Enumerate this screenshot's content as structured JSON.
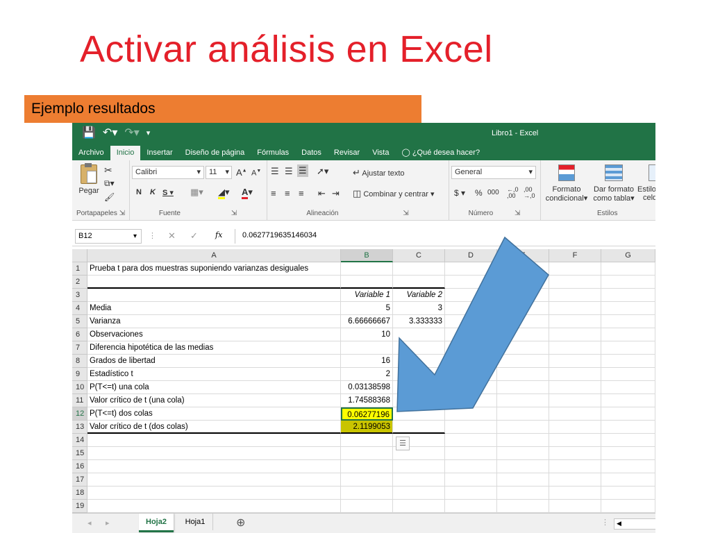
{
  "slide": {
    "title": "Activar análisis en Excel",
    "banner": "Ejemplo resultados"
  },
  "excel": {
    "window_title": "Libro1 - Excel",
    "menu_tabs": [
      "Archivo",
      "Inicio",
      "Insertar",
      "Diseño de página",
      "Fórmulas",
      "Datos",
      "Revisar",
      "Vista"
    ],
    "tell_me": "¿Qué desea hacer?",
    "ribbon": {
      "paste": "Pegar",
      "font_name": "Calibri",
      "font_size": "11",
      "wrap_text": "Ajustar texto",
      "merge_center": "Combinar y centrar",
      "number_format": "General",
      "conditional_format_1": "Formato",
      "conditional_format_2": "condicional",
      "format_table_1": "Dar formato",
      "format_table_2": "como tabla",
      "cell_styles_1": "Estilo",
      "cell_styles_2": "celd",
      "group_portapapeles": "Portapapeles",
      "group_fuente": "Fuente",
      "group_alineacion": "Alineación",
      "group_numero": "Número",
      "group_estilos": "Estilos"
    },
    "name_box": "B12",
    "formula_value": "0.0627719635146034",
    "columns": [
      "A",
      "B",
      "C",
      "D",
      "E",
      "F",
      "G"
    ],
    "rows": [
      {
        "n": "1",
        "a": "Prueba t para dos muestras suponiendo varianzas desiguales",
        "b": "",
        "c": ""
      },
      {
        "n": "2",
        "a": "",
        "b": "",
        "c": ""
      },
      {
        "n": "3",
        "a": "",
        "b": "Variable 1",
        "c": "Variable 2"
      },
      {
        "n": "4",
        "a": "Media",
        "b": "5",
        "c": "3"
      },
      {
        "n": "5",
        "a": "Varianza",
        "b": "6.66666667",
        "c": "3.333333"
      },
      {
        "n": "6",
        "a": "Observaciones",
        "b": "10",
        "c": ""
      },
      {
        "n": "7",
        "a": "Diferencia hipotética de las medias",
        "b": "",
        "c": ""
      },
      {
        "n": "8",
        "a": "Grados de libertad",
        "b": "16",
        "c": ""
      },
      {
        "n": "9",
        "a": "Estadístico t",
        "b": "2",
        "c": ""
      },
      {
        "n": "10",
        "a": "P(T<=t) una cola",
        "b": "0.03138598",
        "c": ""
      },
      {
        "n": "11",
        "a": "Valor crítico de t (una cola)",
        "b": "1.74588368",
        "c": ""
      },
      {
        "n": "12",
        "a": "P(T<=t) dos colas",
        "b": "0.06277196",
        "c": ""
      },
      {
        "n": "13",
        "a": "Valor crítico de t (dos colas)",
        "b": "2.1199053",
        "c": ""
      },
      {
        "n": "14",
        "a": "",
        "b": "",
        "c": ""
      },
      {
        "n": "15",
        "a": "",
        "b": "",
        "c": ""
      },
      {
        "n": "16",
        "a": "",
        "b": "",
        "c": ""
      },
      {
        "n": "17",
        "a": "",
        "b": "",
        "c": ""
      },
      {
        "n": "18",
        "a": "",
        "b": "",
        "c": ""
      },
      {
        "n": "19",
        "a": "",
        "b": "",
        "c": ""
      }
    ],
    "sheet_tabs": [
      "Hoja2",
      "Hoja1"
    ],
    "colors": {
      "excel_green": "#217346",
      "highlight": "#ffff00",
      "arrow": "#5b9bd5",
      "banner": "#ed7d31",
      "title": "#e4202a"
    }
  }
}
